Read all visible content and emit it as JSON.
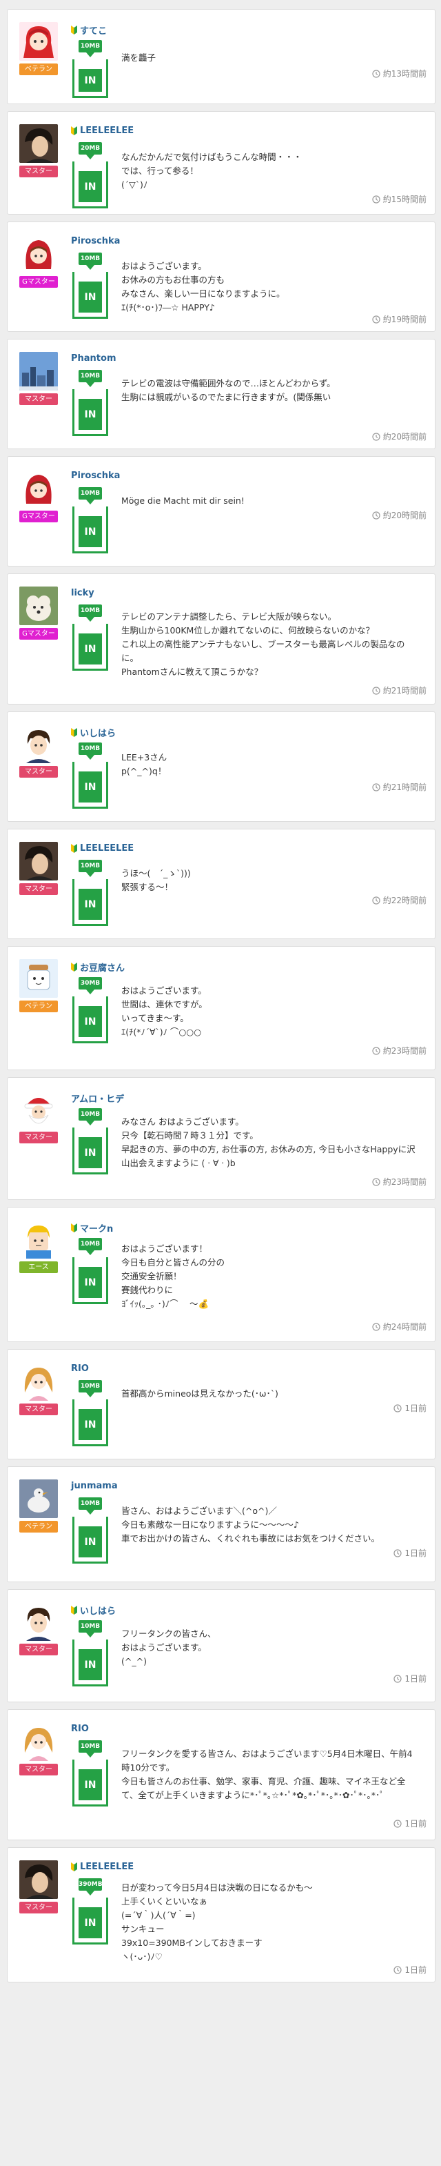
{
  "colors": {
    "accent_green": "#25a145",
    "username_blue": "#2a6496",
    "rank_veteran": "#f2962c",
    "rank_master": "#e2486b",
    "rank_gmaster": "#e020d0",
    "rank_ace": "#7fb52b"
  },
  "posts": [
    {
      "username": "すてこ",
      "leaf": true,
      "rank": "ベテラン",
      "rank_color": "#f2962c",
      "mb": "10MB",
      "in": "IN",
      "message": "満を龘子",
      "time": "約13時間前",
      "avatar_icon": "red-hair-girl-avatar-icon"
    },
    {
      "username": "LEELEELEE",
      "leaf": true,
      "rank": "マスター",
      "rank_color": "#e2486b",
      "mb": "20MB",
      "in": "IN",
      "message": "なんだかんだで気付けばもうこんな時間・・・\nでは、行って参る！\n(´▽`)ﾉ",
      "time": "約15時間前",
      "avatar_icon": "dark-hair-man-avatar-icon"
    },
    {
      "username": "Piroschka",
      "leaf": false,
      "rank": "Gマスター",
      "rank_color": "#e020d0",
      "mb": "10MB",
      "in": "IN",
      "message": "おはようございます。\nお休みの方もお仕事の方も\nみなさん、楽しい一日になりますように。\nｴ(ﾁ(*･o･)ﾌ―☆ HAPPY♪",
      "time": "約19時間前",
      "avatar_icon": "red-hood-avatar-icon"
    },
    {
      "username": "Phantom",
      "leaf": false,
      "rank": "マスター",
      "rank_color": "#e2486b",
      "mb": "10MB",
      "in": "IN",
      "message": "テレビの電波は守備範囲外なので…ほとんどわからず。\n生駒には親戚がいるのでたまに行きますが。(関係無い",
      "time": "約20時間前",
      "avatar_icon": "city-photo-avatar-icon"
    },
    {
      "username": "Piroschka",
      "leaf": false,
      "rank": "Gマスター",
      "rank_color": "#e020d0",
      "mb": "10MB",
      "in": "IN",
      "message": "Möge die Macht mit dir sein!",
      "time": "約20時間前",
      "avatar_icon": "red-hood-avatar-icon"
    },
    {
      "username": "licky",
      "leaf": false,
      "rank": "Gマスター",
      "rank_color": "#e020d0",
      "mb": "10MB",
      "in": "IN",
      "message": "テレビのアンテナ調整したら、テレビ大阪が映らない。\n生駒山から100KM位しか離れてないのに、何故映らないのかな？\nこれ以上の高性能アンテナもないし、ブースターも最高レベルの製品なのに。\nPhantomさんに教えて頂こうかな？",
      "time": "約21時間前",
      "avatar_icon": "dog-photo-avatar-icon"
    },
    {
      "username": "いしはら",
      "leaf": true,
      "rank": "マスター",
      "rank_color": "#e2486b",
      "mb": "10MB",
      "in": "IN",
      "message": "LEE+3さん\np(^_^)q！",
      "time": "約21時間前",
      "avatar_icon": "boy-avatar-icon"
    },
    {
      "username": "LEELEELEE",
      "leaf": true,
      "rank": "マスター",
      "rank_color": "#e2486b",
      "mb": "10MB",
      "in": "IN",
      "message": "うほ〜(　´_ゝ`)))\n緊張する〜！",
      "time": "約22時間前",
      "avatar_icon": "dark-hair-man-avatar-icon"
    },
    {
      "username": "お豆腐さん",
      "leaf": true,
      "rank": "ベテラン",
      "rank_color": "#f2962c",
      "mb": "30MB",
      "in": "IN",
      "message": "おはようございます。\n世間は、連休ですが。\nいってきま〜す。\nｴ(ﾁ(*ﾉ´∀`)ﾉ ⌒○○○",
      "time": "約23時間前",
      "avatar_icon": "tofu-avatar-icon"
    },
    {
      "username": "アムロ・ヒデ",
      "leaf": false,
      "rank": "マスター",
      "rank_color": "#e2486b",
      "mb": "10MB",
      "in": "IN",
      "message": "みなさん おはようございます。\n只今【乾石時間７時３１分】です。\n早起きの方、夢の中の方, お仕事の方, お休みの方, 今日も小さなHappyに沢山出会えますように (ㆍ∀ㆍ)b",
      "time": "約23時間前",
      "avatar_icon": "santa-avatar-icon"
    },
    {
      "username": "マークn",
      "leaf": true,
      "rank": "エース",
      "rank_color": "#7fb52b",
      "mb": "10MB",
      "in": "IN",
      "message": "おはようございます！\n今日も自分と皆さんの分の\n交通安全祈願！\n賽銭代わりに\nﾖﾞｲｯ(｡_｡ ･)ﾉ⌒　 〜💰",
      "time": "約24時間前",
      "avatar_icon": "yellow-hair-avatar-icon"
    },
    {
      "username": "RIO",
      "leaf": false,
      "rank": "マスター",
      "rank_color": "#e2486b",
      "mb": "10MB",
      "in": "IN",
      "message": "首都高からmineoは見えなかった(･ω･`)",
      "time": "1日前",
      "avatar_icon": "anime-girl-avatar-icon"
    },
    {
      "username": "junmama",
      "leaf": false,
      "rank": "ベテラン",
      "rank_color": "#f2962c",
      "mb": "10MB",
      "in": "IN",
      "message": "皆さん、おはようございます＼(^o^)／\n今日も素敵な一日になりますように〜〜〜〜♪\n車でお出かけの皆さん、くれぐれも事故にはお気をつけください。",
      "time": "1日前",
      "avatar_icon": "bird-photo-avatar-icon"
    },
    {
      "username": "いしはら",
      "leaf": true,
      "rank": "マスター",
      "rank_color": "#e2486b",
      "mb": "10MB",
      "in": "IN",
      "message": "フリータンクの皆さん、\nおはようございます。\n(^_^)",
      "time": "1日前",
      "avatar_icon": "boy-avatar-icon"
    },
    {
      "username": "RIO",
      "leaf": false,
      "rank": "マスター",
      "rank_color": "#e2486b",
      "mb": "10MB",
      "in": "IN",
      "message": "フリータンクを愛する皆さん、おはようございます♡5月4日木曜日、午前4時10分です。\n今日も皆さんのお仕事、勉学、家事、育児、介護、趣味、マイネ王など全て、全てが上手くいきますように*･ﾟ*｡☆*･ﾟ*✿｡*･ﾟ*･｡*･✿･ﾟ*･｡*･ﾟ",
      "time": "1日前",
      "avatar_icon": "anime-girl-avatar-icon"
    },
    {
      "username": "LEELEELEE",
      "leaf": true,
      "rank": "マスター",
      "rank_color": "#e2486b",
      "mb": "390MB",
      "in": "IN",
      "message": "日が変わって今日5月4日は決戦の日になるかも〜\n上手くいくといいなぁ\n(=´∀｀)人(´∀｀=)\nサンキュー\n39x10=390MBインしておきまーす\nヽ(･ᴗ･)ﾉ♡",
      "time": "1日前",
      "avatar_icon": "dark-hair-man-avatar-icon"
    }
  ]
}
